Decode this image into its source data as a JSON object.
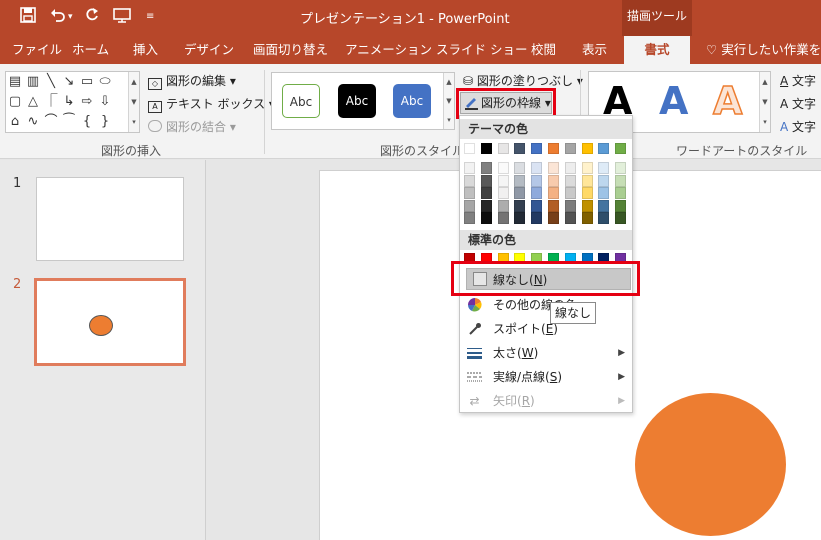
{
  "title_bar": {
    "document_title": "プレゼンテーション1 - PowerPoint",
    "contextual_header": "描画ツール",
    "qat_icons": [
      "save-icon",
      "undo-icon",
      "redo-icon",
      "present-icon",
      "customize-icon"
    ]
  },
  "tabs": [
    {
      "label": "ファイル"
    },
    {
      "label": "ホーム"
    },
    {
      "label": "挿入"
    },
    {
      "label": "デザイン"
    },
    {
      "label": "画面切り替え"
    },
    {
      "label": "アニメーション"
    },
    {
      "label": "スライド ショー"
    },
    {
      "label": "校閲"
    },
    {
      "label": "表示"
    },
    {
      "label": "書式",
      "active": true
    }
  ],
  "tell_me": "実行したい作業を入力",
  "ribbon": {
    "insert_shapes": {
      "label": "図形の挿入",
      "edit_shape": "図形の編集",
      "text_box": "テキスト ボックス",
      "merge_shapes": "図形の結合"
    },
    "shape_styles": {
      "label": "図形のスタイル",
      "samples": [
        "Abc",
        "Abc",
        "Abc"
      ],
      "fill": "図形の塗りつぶし",
      "outline": "図形の枠線"
    },
    "wordart_styles": {
      "label": "ワードアートのスタイル",
      "samples": [
        "A",
        "A",
        "A"
      ],
      "text_commands": [
        "文字",
        "文字",
        "文字"
      ]
    }
  },
  "slides": [
    {
      "number": "1"
    },
    {
      "number": "2",
      "selected": true
    }
  ],
  "dropdown": {
    "theme_colors_header": "テーマの色",
    "theme_colors_top": [
      "#ffffff",
      "#000000",
      "#e7e6e6",
      "#44546a",
      "#4472c4",
      "#ed7d31",
      "#a5a5a5",
      "#ffc000",
      "#5b9bd5",
      "#70ad47"
    ],
    "standard_colors_header": "標準の色",
    "standard_colors": [
      "#c00000",
      "#ff0000",
      "#ffc000",
      "#ffff00",
      "#92d050",
      "#00b050",
      "#00b0f0",
      "#0070c0",
      "#002060",
      "#7030a0"
    ],
    "items": {
      "no_outline": {
        "text": "線なし(",
        "key": "N",
        "tail": ")"
      },
      "more_colors": {
        "text": "その他の線の色..."
      },
      "eyedropper": {
        "text": "スポイト(",
        "key": "E",
        "tail": ")"
      },
      "weight": {
        "text": "太さ(",
        "key": "W",
        "tail": ")"
      },
      "dashes": {
        "text": "実線/点線(",
        "key": "S",
        "tail": ")"
      },
      "arrows": {
        "text": "矢印(",
        "key": "R",
        "tail": ")"
      }
    },
    "tooltip": "線なし"
  },
  "colors": {
    "accent": "#b7472a",
    "shape_fill": "#ed7d31",
    "highlight": "#e50012"
  }
}
